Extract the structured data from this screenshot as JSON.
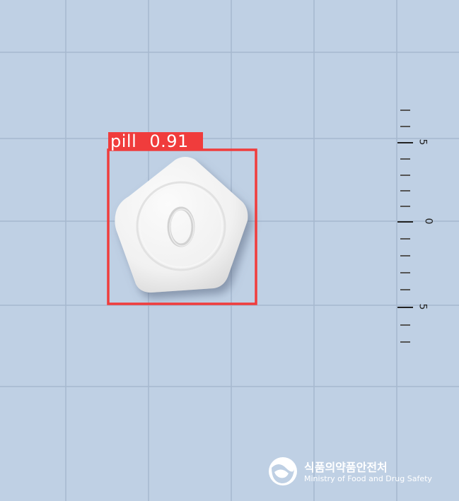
{
  "detection": {
    "class_label": "pill",
    "confidence": "0.91",
    "box_color": "#f03c3c"
  },
  "pill": {
    "imprint": "O",
    "shape": "pentagon",
    "color": "white"
  },
  "ruler": {
    "labels": [
      "5",
      "0",
      "5"
    ]
  },
  "background": {
    "color": "#bfd0e4",
    "grid_color": "#a6b8cf"
  },
  "logo": {
    "korean": "식품의약품안전처",
    "english": "Ministry of Food and Drug Safety"
  }
}
